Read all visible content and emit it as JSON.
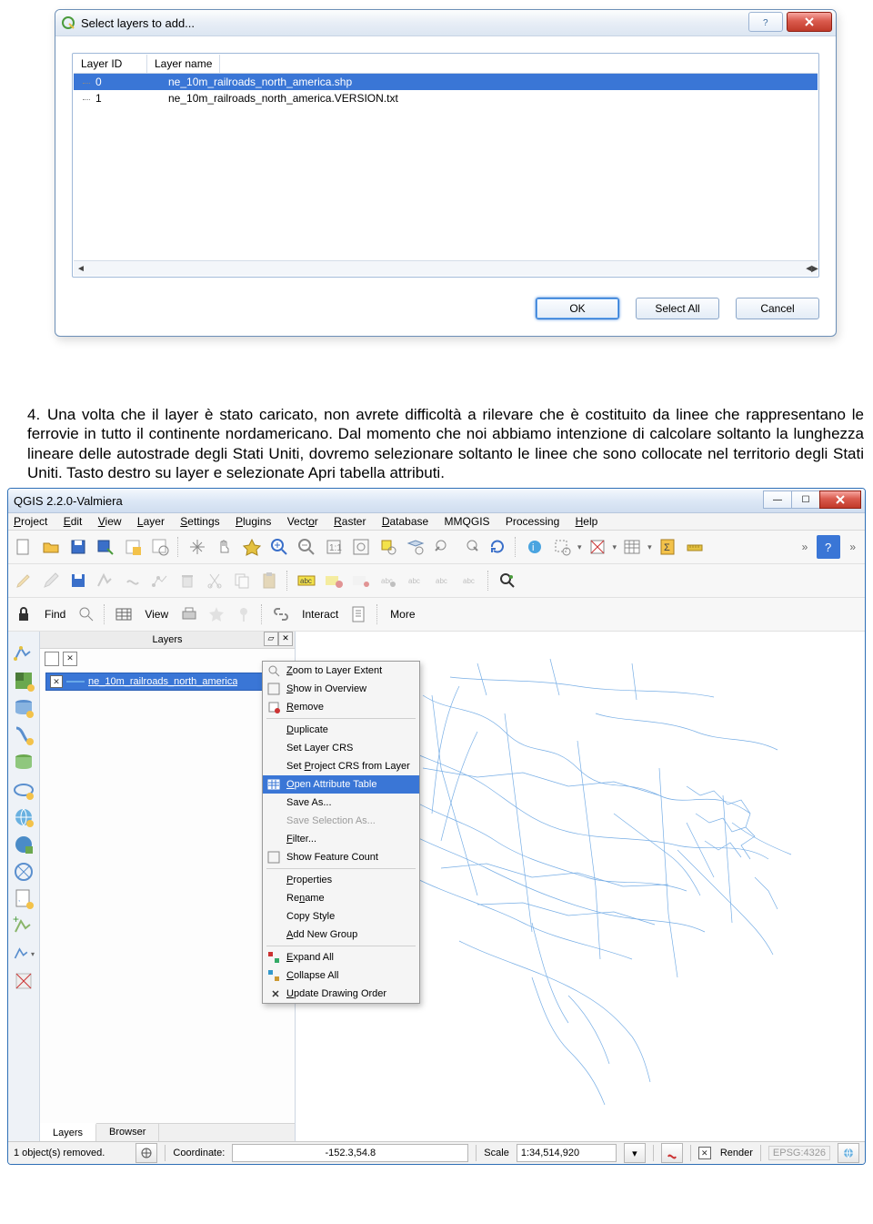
{
  "dialog1": {
    "title": "Select layers to add...",
    "columns": {
      "id": "Layer ID",
      "name": "Layer name"
    },
    "rows": [
      {
        "id": "0",
        "name": "ne_10m_railroads_north_america.shp",
        "selected": true
      },
      {
        "id": "1",
        "name": "ne_10m_railroads_north_america.VERSION.txt",
        "selected": false
      }
    ],
    "buttons": {
      "ok": "OK",
      "select_all": "Select All",
      "cancel": "Cancel"
    }
  },
  "paragraph": {
    "num": "4.",
    "text": "Una volta che il layer è stato caricato, non avrete difficoltà a rilevare che è costituito da linee che rappresentano le ferrovie in tutto il continente nordamericano. Dal momento che noi abbiamo intenzione di calcolare soltanto la lunghezza lineare delle autostrade degli Stati Uniti, dovremo selezionare soltanto le linee che sono collocate nel territorio degli Stati Uniti. Tasto destro su layer e selezionate Apri tabella attributi."
  },
  "qgis": {
    "title": "QGIS 2.2.0-Valmiera",
    "menu": [
      "Project",
      "Edit",
      "View",
      "Layer",
      "Settings",
      "Plugins",
      "Vector",
      "Raster",
      "Database",
      "MMQGIS",
      "Processing",
      "Help"
    ],
    "toolbar3": {
      "find": "Find",
      "view": "View",
      "interact": "Interact",
      "more": "More"
    },
    "layers_panel": {
      "title": "Layers",
      "layer_name": "ne_10m_railroads_north_america",
      "tabs": {
        "layers": "Layers",
        "browser": "Browser"
      }
    },
    "context_menu": {
      "items": [
        {
          "label": "Zoom to Layer Extent",
          "u": "Z"
        },
        {
          "label": "Show in Overview",
          "u": "S"
        },
        {
          "label": "Remove",
          "u": "R"
        },
        {
          "label": "Duplicate",
          "u": "D"
        },
        {
          "label": "Set Layer CRS",
          "u": null
        },
        {
          "label": "Set Project CRS from Layer",
          "u": "P"
        },
        {
          "label": "Open Attribute Table",
          "u": "O",
          "selected": true
        },
        {
          "label": "Save As...",
          "u": null
        },
        {
          "label": "Save Selection As...",
          "u": null,
          "disabled": true
        },
        {
          "label": "Filter...",
          "u": "F"
        },
        {
          "label": "Show Feature Count",
          "u": null
        },
        {
          "label": "Properties",
          "u": "P"
        },
        {
          "label": "Rename",
          "u": "n"
        },
        {
          "label": "Copy Style",
          "u": null
        },
        {
          "label": "Add New Group",
          "u": "A"
        },
        {
          "label": "Expand All",
          "u": "E"
        },
        {
          "label": "Collapse All",
          "u": "C"
        },
        {
          "label": "Update Drawing Order",
          "u": "U"
        }
      ]
    },
    "statusbar": {
      "message": "1 object(s) removed.",
      "coord_label": "Coordinate:",
      "coord_value": "-152.3,54.8",
      "scale_label": "Scale",
      "scale_value": "1:34,514,920",
      "render": "Render",
      "epsg": "EPSG:4326"
    }
  }
}
